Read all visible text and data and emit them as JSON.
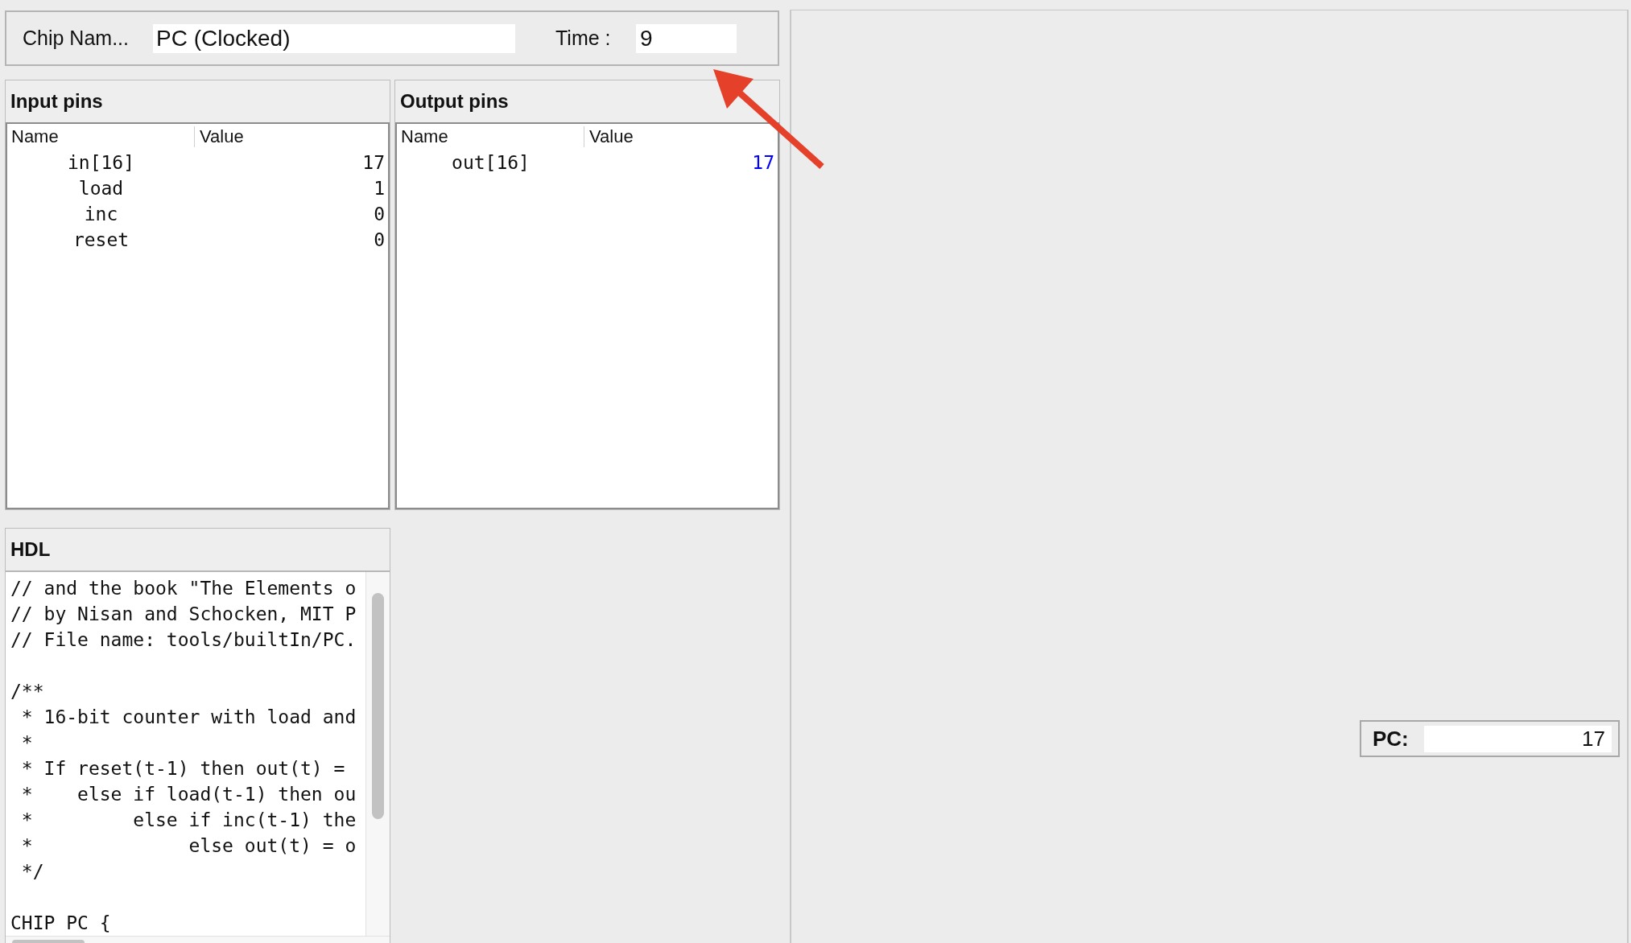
{
  "chip": {
    "label": "Chip Nam...",
    "value": "PC (Clocked)"
  },
  "time": {
    "label": "Time :",
    "value": "9"
  },
  "input_pins": {
    "title": "Input pins",
    "columns": [
      "Name",
      "Value"
    ],
    "rows": [
      {
        "name": "in[16]",
        "value": "17",
        "changed": false
      },
      {
        "name": "load",
        "value": "1",
        "changed": false
      },
      {
        "name": "inc",
        "value": "0",
        "changed": false
      },
      {
        "name": "reset",
        "value": "0",
        "changed": false
      }
    ]
  },
  "output_pins": {
    "title": "Output pins",
    "columns": [
      "Name",
      "Value"
    ],
    "rows": [
      {
        "name": "out[16]",
        "value": "17",
        "changed": true
      }
    ]
  },
  "hdl": {
    "title": "HDL",
    "code": "// and the book \"The Elements o\n// by Nisan and Schocken, MIT P\n// File name: tools/builtIn/PC.\n\n/**\n * 16-bit counter with load and\n *\n * If reset(t-1) then out(t) =\n *    else if load(t-1) then ou\n *         else if inc(t-1) the\n *              else out(t) = o\n */\n\nCHIP PC {"
  },
  "registers": [
    {
      "label": "PC:",
      "value": "17"
    }
  ]
}
